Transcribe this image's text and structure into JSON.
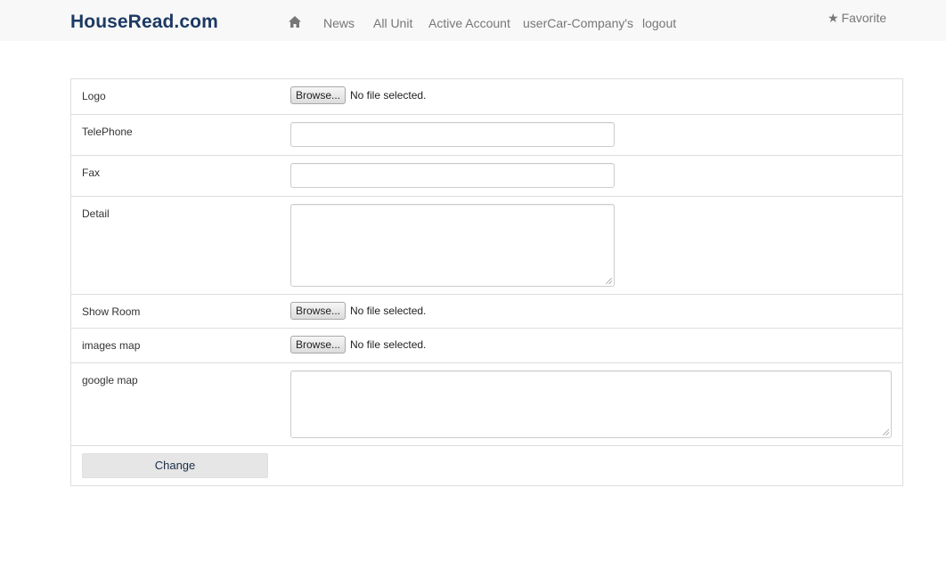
{
  "navbar": {
    "brand": "HouseRead.com",
    "home_icon": "home-icon",
    "links": [
      "News",
      "All Unit",
      "Active Account",
      "userCar-Company's",
      "logout"
    ],
    "favorite_icon": "star-icon",
    "favorite_label": "Favorite"
  },
  "form": {
    "logo": {
      "label": "Logo",
      "browse": "Browse...",
      "status": "No file selected."
    },
    "telephone": {
      "label": "TelePhone",
      "value": ""
    },
    "fax": {
      "label": "Fax",
      "value": ""
    },
    "detail": {
      "label": "Detail",
      "value": ""
    },
    "show_room": {
      "label": "Show Room",
      "browse": "Browse...",
      "status": "No file selected."
    },
    "images_map": {
      "label": "images map",
      "browse": "Browse...",
      "status": "No file selected."
    },
    "google_map": {
      "label": "google map",
      "value": ""
    },
    "submit_label": "Change"
  },
  "colors": {
    "brand": "#1c3a63",
    "nav_link": "#777777",
    "navbar_bg": "#f8f8f8",
    "border": "#dddddd",
    "button_bg": "#e6e6e6"
  }
}
